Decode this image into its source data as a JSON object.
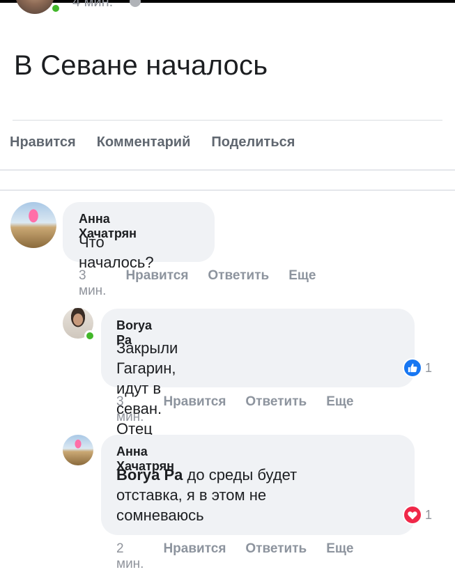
{
  "post": {
    "meta_time": "4 мин.",
    "text": "В Севане началось",
    "actions": {
      "like": "Нравится",
      "comment": "Комментарий",
      "share": "Поделиться"
    }
  },
  "comments": [
    {
      "author": "Анна Хачатрян",
      "text": "Что началось?",
      "time": "3 мин.",
      "like": "Нравится",
      "reply": "Ответить",
      "more": "Еще"
    },
    {
      "author": "Borya Pa",
      "text": "Закрыли Гагарин, идут в севан.\nОтец никола тоже там",
      "reaction_count": "1",
      "reaction_type": "like-icon",
      "time": "3 мин.",
      "like": "Нравится",
      "reply": "Ответить",
      "more": "Еще"
    },
    {
      "author": "Анна Хачатрян",
      "mention": "Borya Pa",
      "text": " до среды будет\nотставка, я в этом не\nсомневаюсь",
      "reaction_count": "1",
      "reaction_type": "heart-icon",
      "time": "2 мин.",
      "like": "Нравится",
      "reply": "Ответить",
      "more": "Еще"
    }
  ],
  "colors": {
    "like_blue": "#1877f2",
    "love_red": "#f02849",
    "online_green": "#42b72a",
    "bubble": "#f0f2f5"
  }
}
